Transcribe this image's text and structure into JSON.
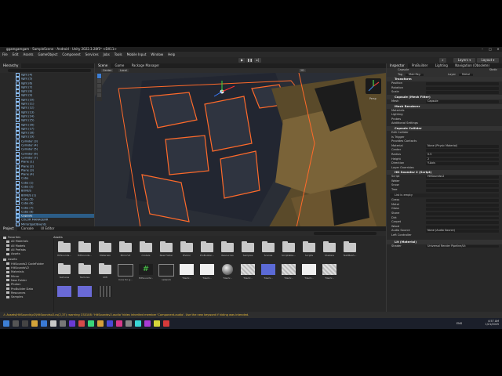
{
  "window": {
    "title": "ggamgamgam - SampleScene - Android - Unity 2022.3.28f1* <DX11>"
  },
  "menu": [
    "File",
    "Edit",
    "Assets",
    "GameObject",
    "Component",
    "Services",
    "Jobs",
    "Tools",
    "Mobile Input",
    "Window",
    "Help"
  ],
  "toolbar": {
    "layers": "Layers",
    "layout": "Layout"
  },
  "hierarchy": {
    "tab": "Hierarchy",
    "items": [
      "light (4)",
      "light (5)",
      "light (6)",
      "light (7)",
      "light (8)",
      "light (9)",
      "light (10)",
      "light (11)",
      "light (12)",
      "light (13)",
      "light (14)",
      "light (15)",
      "light (16)",
      "light (17)",
      "light (18)",
      "light (19)",
      "Cylinder (3)",
      "Cylinder (4)",
      "Cylinder (5)",
      "Cylinder (6)",
      "Cylinder (7)",
      "Plane (1)",
      "Plane (2)",
      "Plane (3)",
      "Plane (4)",
      "Cube",
      "Cube (1)",
      "Cube (2)",
      "BONUS",
      "BONUS (1)",
      "Cube (5)",
      "Cube (6)",
      "Cube (7)",
      "Cube (8)",
      "Capsule",
      "COLOR MANAGERR",
      "MirrorSpotlEvents",
      "Core for ghamgamgam"
    ]
  },
  "scene": {
    "tabs": [
      "Scene",
      "Game",
      "Package Manager"
    ],
    "center": "Center",
    "local": "Local",
    "persp": "Persp",
    "mode": "2D"
  },
  "inspector": {
    "tabs": [
      "Inspector",
      "ProBuilder",
      "Lighting",
      "Navigation (Obsolete)"
    ],
    "object_name": "Capsule",
    "static": "Static",
    "tag_label": "Tag",
    "tag": "MainTag",
    "layer_label": "Layer",
    "layer": "Metal",
    "transform": {
      "title": "Transform",
      "position": "Position",
      "rotation": "Rotation",
      "scale": "Scale"
    },
    "mesh_filter": {
      "title": "Capsule (Mesh Filter)",
      "mesh_label": "Mesh",
      "mesh": "Capsule"
    },
    "mesh_renderer": {
      "title": "Mesh Renderer",
      "rows": [
        "Materials",
        "Lighting",
        "Probes",
        "Additional Settings"
      ]
    },
    "collider": {
      "title": "Capsule Collider",
      "edit": "Edit Collider",
      "is_trigger": "Is Trigger",
      "provides_contacts": "Provides Contacts",
      "material_label": "Material",
      "material": "None (Physic Material)",
      "center": "Center",
      "radius": "Radius",
      "radius_val": "0.5",
      "height": "Height",
      "height_val": "2",
      "direction": "Direction",
      "direction_val": "Y-Axis",
      "layer_overrides": "Layer Overrides"
    },
    "script": {
      "title": "Hit Soundsv 2 (Script)",
      "script_label": "Script",
      "script": "HitSoundsv2",
      "rows": [
        "Water",
        "Snow",
        "Tree"
      ],
      "list_empty": "List is empty",
      "rows2": [
        "Grass",
        "Metal",
        "Glass",
        "Stone",
        "Dirt",
        "Carpet",
        "Wood"
      ],
      "audio_label": "Audio Source",
      "audio": "None (Audio Source)",
      "left_controller": "Left Controller"
    },
    "material": "Lit (Material)",
    "shader_label": "Shader",
    "shader": "Universal Render Pipeline/Lit"
  },
  "project": {
    "tabs": [
      "Project",
      "Console",
      "UI Editor"
    ],
    "favorites": [
      "Favorites",
      "All Materials",
      "All Models",
      "All Prefabs",
      "Assets"
    ],
    "tree": [
      "Assets",
      "HitSounds2 CodeFolder",
      "HitSoundsV2",
      "Materials",
      "Mirror",
      "New Folder",
      "Photon",
      "ProBuilder Data",
      "Resources",
      "Samples"
    ],
    "assets_label": "Assets",
    "row1": [
      "HitSounds...",
      "HitSounds...",
      "Materials",
      "MirrorV2",
      "models",
      "New Folder",
      "Photon",
      "ProBuilder...",
      "Resources",
      "Samples",
      "Scenes",
      "Scriptable...",
      "Scripts",
      "Shaders",
      "TextMesh..."
    ],
    "row2": [
      "textures",
      "Textures",
      "UMI",
      "Core for g...",
      "HitSoundV...",
      "network",
      "TileoV...",
      "TileoV...",
      "TileoV...",
      "TileoV...",
      "TileoV...",
      "TileoV...",
      "TileoV...",
      "TileoV..."
    ]
  },
  "status_text": "Assets\\HitSounds\\v2\\HitSoundsv2.cs(2,37): warning CS0108: 'HitSoundsv2.audio' hides inherited member 'Component.audio'. Use the new keyword if hiding was intended.",
  "taskbar": {
    "lang": "ENG",
    "time": "4:57 AM",
    "date": "1/21/2025"
  },
  "colors": {
    "accent": "#3d7fd6",
    "outline": "#ff6a2a",
    "warning": "#e6b93a"
  }
}
